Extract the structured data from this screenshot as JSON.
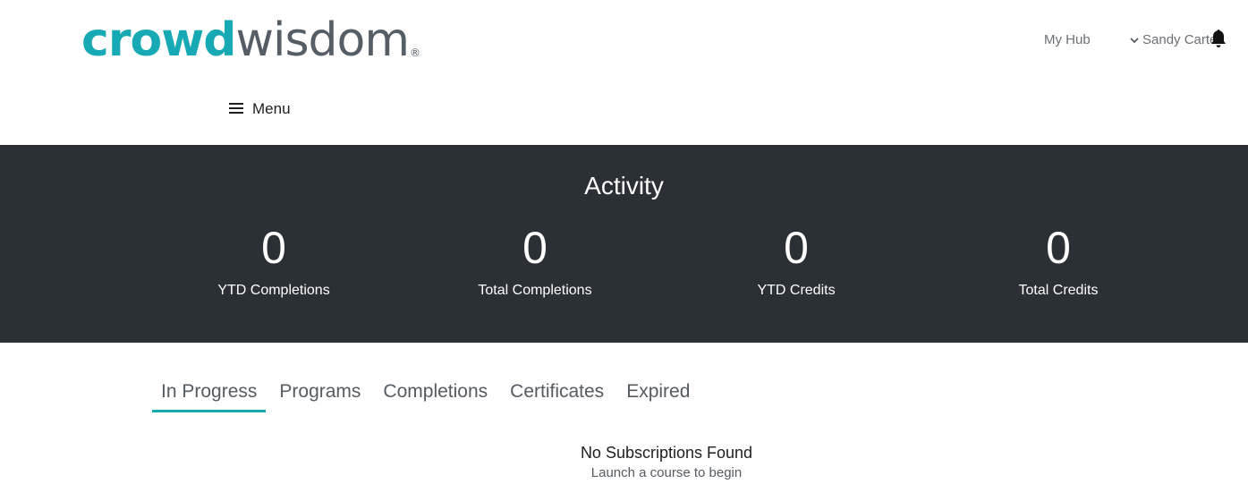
{
  "header": {
    "logo_part1": "crowd",
    "logo_part2": "wisdom",
    "logo_reg": "®",
    "my_hub": "My Hub",
    "user_name": "Sandy Carter",
    "menu_label": "Menu"
  },
  "activity": {
    "title": "Activity",
    "stats": [
      {
        "value": "0",
        "label": "YTD Completions"
      },
      {
        "value": "0",
        "label": "Total Completions"
      },
      {
        "value": "0",
        "label": "YTD Credits"
      },
      {
        "value": "0",
        "label": "Total Credits"
      }
    ]
  },
  "tabs": [
    {
      "label": "In Progress",
      "active": true
    },
    {
      "label": "Programs"
    },
    {
      "label": "Completions"
    },
    {
      "label": "Certificates"
    },
    {
      "label": "Expired"
    }
  ],
  "empty_state": {
    "title": "No Subscriptions Found",
    "subtitle": "Launch a course to begin"
  },
  "colors": {
    "brand": "#17a9b4",
    "logo_gray": "#555e66",
    "band": "#2b2f36"
  },
  "icons": [
    "chevron-down-icon",
    "bell-icon",
    "hamburger-icon"
  ]
}
